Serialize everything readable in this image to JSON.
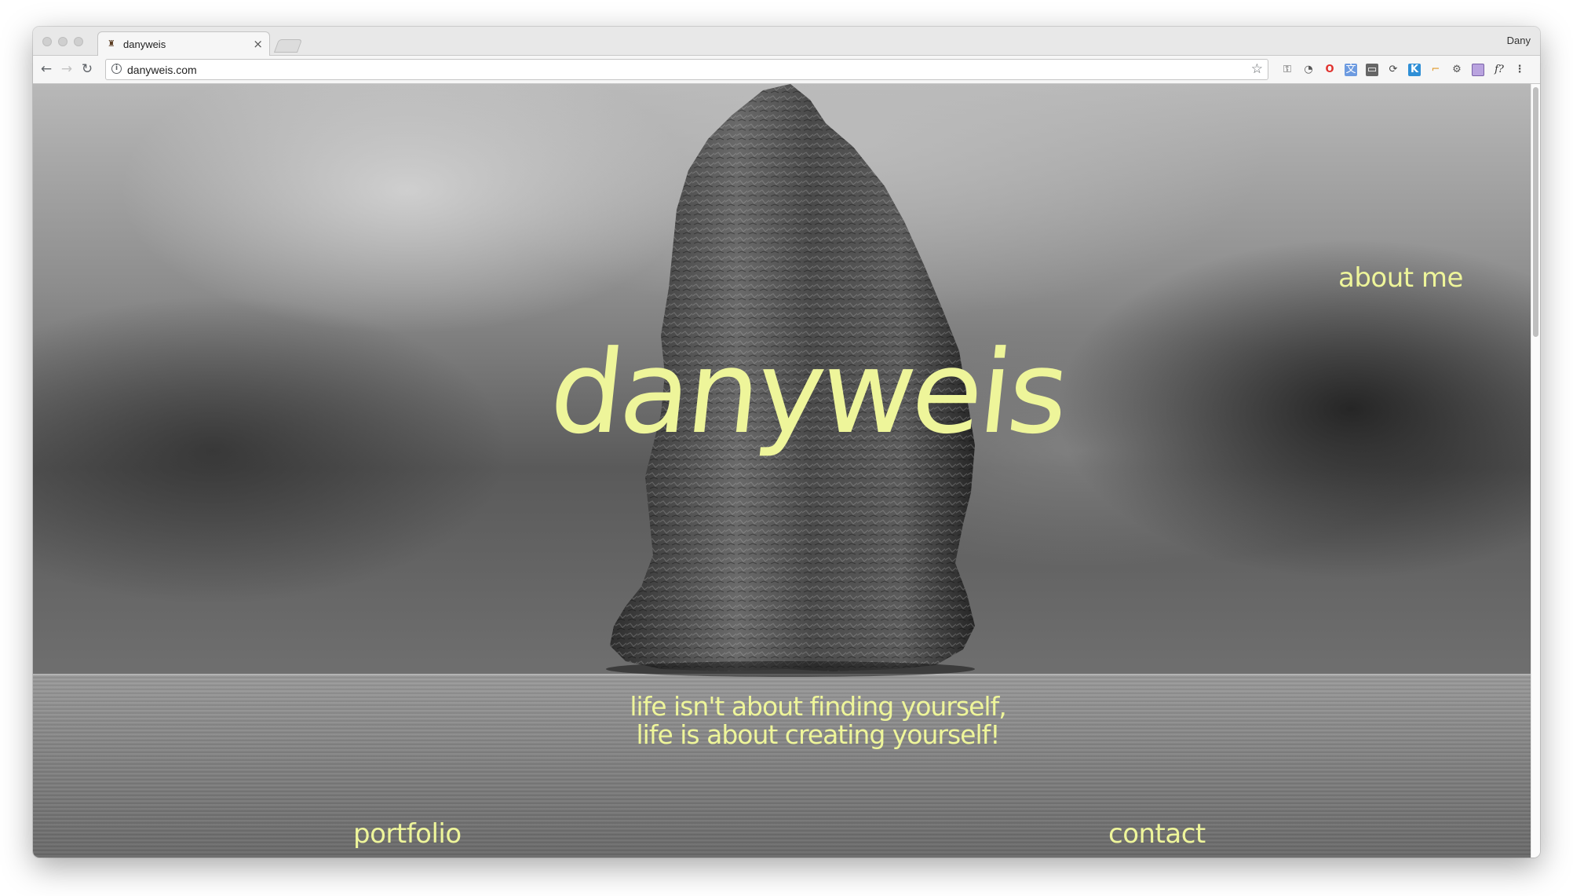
{
  "browser": {
    "tab_title": "danyweis",
    "tab_favicon": "site-favicon",
    "close_glyph": "×",
    "profile_name": "Dany",
    "url": "danyweis.com",
    "nav": {
      "back_icon": "back-arrow-icon",
      "forward_icon": "forward-arrow-icon",
      "reload_icon": "reload-icon"
    },
    "extensions": [
      "extension-puzzle-icon",
      "speed-gauge-icon",
      "opera-icon",
      "translate-icon",
      "window-icon",
      "sync-icon",
      "k-icon",
      "highlighter-icon",
      "gear-icon",
      "purple-square-icon",
      "fx-icon",
      "menu-dots-icon"
    ]
  },
  "site": {
    "title": "danyweis",
    "nav": {
      "about": "about me",
      "portfolio": "portfolio",
      "contact": "contact"
    },
    "tagline_line1": "life isn't about finding yourself,",
    "tagline_line2": "life is about creating yourself!",
    "accent_color": "#eef59a",
    "background": "black-and-white photo of a sea stack rock under stormy sky"
  }
}
